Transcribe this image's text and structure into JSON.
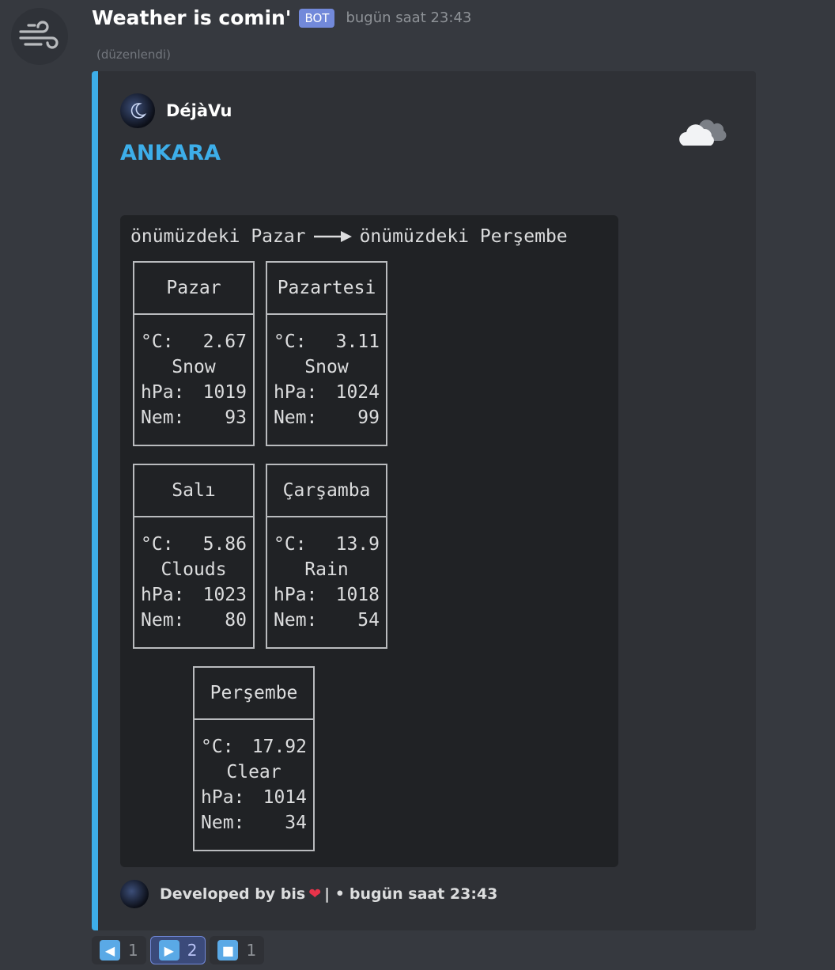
{
  "message": {
    "username": "Weather is comin'",
    "badge": "BOT",
    "timestamp": "bugün saat 23:43",
    "edited": "(düzenlendi)"
  },
  "embed": {
    "accent_color": "#3daee9",
    "author": "DéjàVu",
    "title": "ANKARA",
    "thumbnail_icon": "cloud-icon",
    "range_from": "önümüzdeki Pazar",
    "range_to": "önümüzdeki Perşembe",
    "days": [
      {
        "name": "Pazar",
        "temp_label": "°C:",
        "temp": "2.67",
        "condition": "Snow",
        "hpa_label": "hPa:",
        "hpa": "1019",
        "nem_label": "Nem:",
        "nem": "93"
      },
      {
        "name": "Pazartesi",
        "temp_label": "°C:",
        "temp": "3.11",
        "condition": "Snow",
        "hpa_label": "hPa:",
        "hpa": "1024",
        "nem_label": "Nem:",
        "nem": "99"
      },
      {
        "name": "Salı",
        "temp_label": "°C:",
        "temp": "5.86",
        "condition": "Clouds",
        "hpa_label": "hPa:",
        "hpa": "1023",
        "nem_label": "Nem:",
        "nem": "80"
      },
      {
        "name": "Çarşamba",
        "temp_label": "°C:",
        "temp": "13.9",
        "condition": "Rain",
        "hpa_label": "hPa:",
        "hpa": "1018",
        "nem_label": "Nem:",
        "nem": "54"
      },
      {
        "name": "Perşembe",
        "temp_label": "°C:",
        "temp": "17.92",
        "condition": "Clear",
        "hpa_label": "hPa:",
        "hpa": "1014",
        "nem_label": "Nem:",
        "nem": "34"
      }
    ],
    "footer": {
      "developed_by": "Developed by bis",
      "heart_icon": "heart-icon",
      "separator": "| •",
      "timestamp": "bugün saat 23:43"
    }
  },
  "reactions": [
    {
      "icon": "arrow-left-icon",
      "glyph": "◀",
      "count": "1",
      "active": false
    },
    {
      "icon": "arrow-right-icon",
      "glyph": "▶",
      "count": "2",
      "active": true
    },
    {
      "icon": "stop-icon",
      "glyph": "■",
      "count": "1",
      "active": false
    }
  ]
}
